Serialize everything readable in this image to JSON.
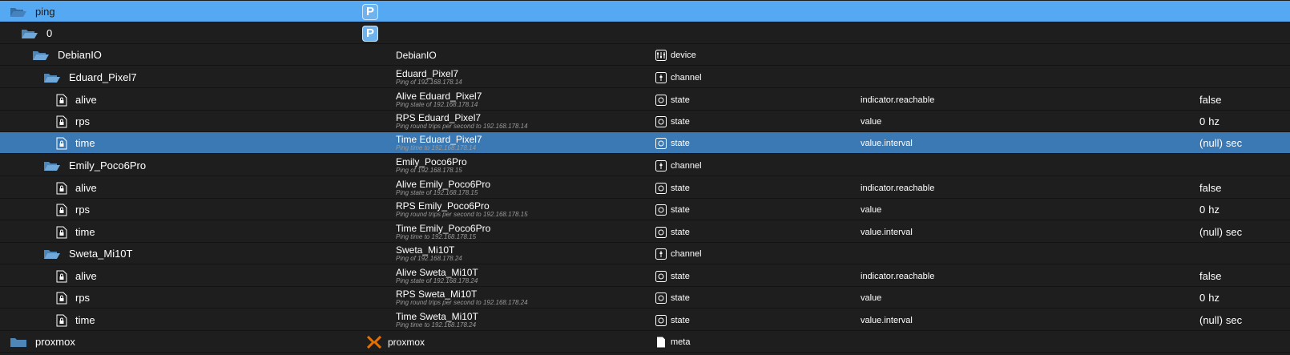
{
  "colors": {
    "background": "#1e1e1e",
    "root_row": "#55a9f2",
    "selected_row": "#3a79b4",
    "folder_icon": "#6fa8d9",
    "description_text": "#9a9a9a"
  },
  "rows": [
    {
      "id": "ping",
      "name": "",
      "desc": "",
      "role": "",
      "type": "",
      "value": "",
      "unit": "",
      "kind": "folder",
      "role_icon": "p-badge-icon"
    },
    {
      "id": "0",
      "name": "",
      "desc": "",
      "role": "",
      "type": "",
      "value": "",
      "unit": "",
      "kind": "folder",
      "role_icon": "p-badge-icon"
    },
    {
      "id": "DebianIO",
      "name": "DebianIO",
      "desc": "",
      "role": "device",
      "type": "",
      "value": "",
      "unit": "",
      "kind": "folder",
      "role_icon": "device-icon"
    },
    {
      "id": "Eduard_Pixel7",
      "name": "Eduard_Pixel7",
      "desc": "Ping of 192.168.178.14",
      "role": "channel",
      "type": "",
      "value": "",
      "unit": "",
      "kind": "folder",
      "role_icon": "channel-icon"
    },
    {
      "id": "alive",
      "name": "Alive Eduard_Pixel7",
      "desc": "Ping state of 192.168.178.14",
      "role": "state",
      "type": "indicator.reachable",
      "value": "false",
      "unit": "",
      "kind": "state",
      "role_icon": "state-icon"
    },
    {
      "id": "rps",
      "name": "RPS Eduard_Pixel7",
      "desc": "Ping round trips per second to 192.168.178.14",
      "role": "state",
      "type": "value",
      "value": "0",
      "unit": "hz",
      "kind": "state",
      "role_icon": "state-icon"
    },
    {
      "id": "time",
      "name": "Time Eduard_Pixel7",
      "desc": "Ping time to 192.168.178.14",
      "role": "state",
      "type": "value.interval",
      "value": "(null)",
      "unit": "sec",
      "kind": "state",
      "role_icon": "state-icon"
    },
    {
      "id": "Emily_Poco6Pro",
      "name": "Emily_Poco6Pro",
      "desc": "Ping of 192.168.178.15",
      "role": "channel",
      "type": "",
      "value": "",
      "unit": "",
      "kind": "folder",
      "role_icon": "channel-icon"
    },
    {
      "id": "alive",
      "name": "Alive Emily_Poco6Pro",
      "desc": "Ping state of 192.168.178.15",
      "role": "state",
      "type": "indicator.reachable",
      "value": "false",
      "unit": "",
      "kind": "state",
      "role_icon": "state-icon"
    },
    {
      "id": "rps",
      "name": "RPS Emily_Poco6Pro",
      "desc": "Ping round trips per second to 192.168.178.15",
      "role": "state",
      "type": "value",
      "value": "0",
      "unit": "hz",
      "kind": "state",
      "role_icon": "state-icon"
    },
    {
      "id": "time",
      "name": "Time Emily_Poco6Pro",
      "desc": "Ping time to 192.168.178.15",
      "role": "state",
      "type": "value.interval",
      "value": "(null)",
      "unit": "sec",
      "kind": "state",
      "role_icon": "state-icon"
    },
    {
      "id": "Sweta_Mi10T",
      "name": "Sweta_Mi10T",
      "desc": "Ping of 192.168.178.24",
      "role": "channel",
      "type": "",
      "value": "",
      "unit": "",
      "kind": "folder",
      "role_icon": "channel-icon"
    },
    {
      "id": "alive",
      "name": "Alive Sweta_Mi10T",
      "desc": "Ping state of 192.168.178.24",
      "role": "state",
      "type": "indicator.reachable",
      "value": "false",
      "unit": "",
      "kind": "state",
      "role_icon": "state-icon"
    },
    {
      "id": "rps",
      "name": "RPS Sweta_Mi10T",
      "desc": "Ping round trips per second to 192.168.178.24",
      "role": "state",
      "type": "value",
      "value": "0",
      "unit": "hz",
      "kind": "state",
      "role_icon": "state-icon"
    },
    {
      "id": "time",
      "name": "Time Sweta_Mi10T",
      "desc": "Ping time to 192.168.178.24",
      "role": "state",
      "type": "value.interval",
      "value": "(null)",
      "unit": "sec",
      "kind": "state",
      "role_icon": "state-icon"
    },
    {
      "id": "proxmox",
      "name": "proxmox",
      "desc": "",
      "role": "meta",
      "type": "",
      "value": "",
      "unit": "",
      "kind": "folder",
      "role_icon": "meta-icon"
    }
  ],
  "badge_letter": "P"
}
